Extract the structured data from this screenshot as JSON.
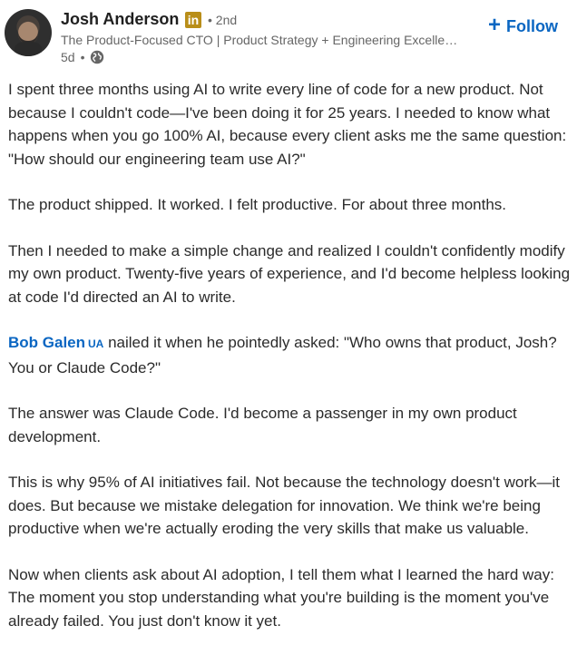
{
  "author": {
    "name": "Josh Anderson",
    "network_badge": "in",
    "degree": "• 2nd",
    "headline": "The Product-Focused CTO | Product Strategy + Engineering Excelle…",
    "time": "5d",
    "time_separator": "•",
    "visibility_icon": "globe-icon"
  },
  "follow": {
    "label": "Follow",
    "icon": "plus-icon"
  },
  "colors": {
    "link": "#0a66c2",
    "linkedin_badge": "#b98e19",
    "text": "#2b2b2b",
    "muted": "#666666"
  },
  "post": {
    "p1": "I spent three months using AI to write every line of code for a new product. Not because I couldn't code—I've been doing it for 25 years. I needed to know what happens when you go 100% AI, because every client asks me the same question: \"How should our engineering team use AI?\"",
    "p2": "The product shipped. It worked. I felt productive. For about three months.",
    "p3": "Then I needed to make a simple change and realized I couldn't confidently modify my own product. Twenty-five years of experience, and I'd become helpless looking at code I'd directed an AI to write.",
    "mention_name": "Bob Galen",
    "mention_tag": "UA",
    "p4_rest": " nailed it when he pointedly asked: \"Who owns that product, Josh? You or Claude Code?\"",
    "p5": "The answer was Claude Code. I'd become a passenger in my own product development.",
    "p6": "This is why 95% of AI initiatives fail. Not because the technology doesn't work—it does. But because we mistake delegation for innovation. We think we're being productive when we're actually eroding the very skills that make us valuable.",
    "p7": "Now when clients ask about AI adoption, I tell them what I learned the hard way: The moment you stop understanding what you're building is the moment you've already failed. You just don't know it yet."
  }
}
